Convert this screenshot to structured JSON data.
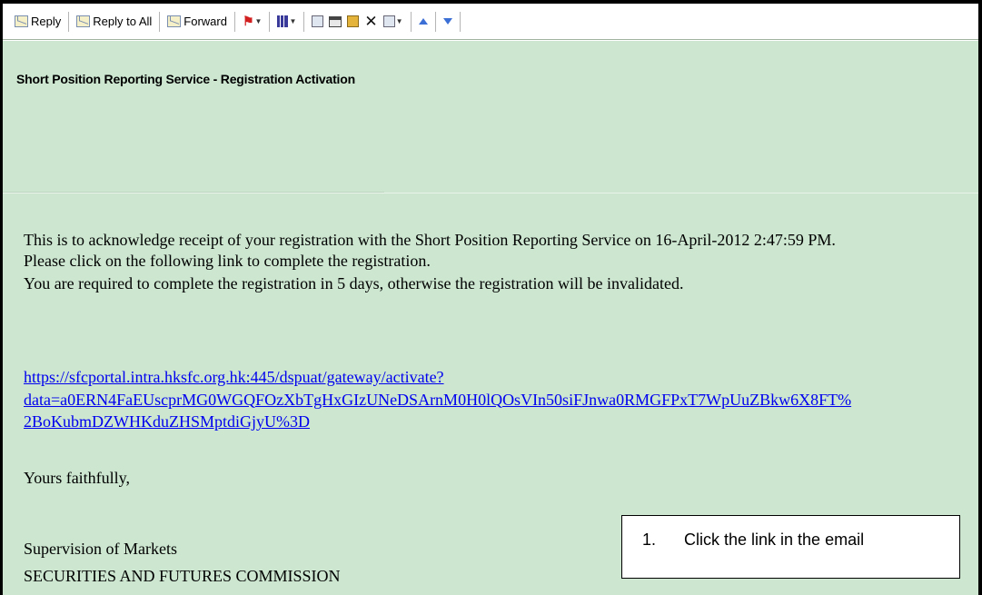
{
  "toolbar": {
    "reply_label": "Reply",
    "reply_all_label": "Reply to All",
    "forward_label": "Forward"
  },
  "email": {
    "subject": "Short Position Reporting Service - Registration Activation",
    "body_line1": "This is to acknowledge receipt of your registration with the Short Position Reporting Service on 16-April-2012 2:47:59 PM.",
    "body_line2": "Please click on the following link to complete the registration.",
    "body_line3": "You are required to complete the registration in 5 days, otherwise the registration will be invalidated.",
    "link_line1": "https://sfcportal.intra.hksfc.org.hk:445/dspuat/gateway/activate?",
    "link_line2": "data=a0ERN4FaEUscprMG0WGQFOzXbTgHxGIzUNeDSArnM0H0lQOsVIn50siFJnwa0RMGFPxT7WpUuZBkw6X8FT%",
    "link_line3": "2BoKubmDZWHKduZHSMptdiGjyU%3D",
    "closing": "Yours faithfully,",
    "signature_line1": "Supervision of Markets",
    "signature_line2": "SECURITIES AND FUTURES COMMISSION"
  },
  "callout": {
    "number": "1.",
    "text": "Click the link in the email"
  },
  "colors": {
    "message_background": "#cce6d0",
    "link": "#0000ee"
  }
}
